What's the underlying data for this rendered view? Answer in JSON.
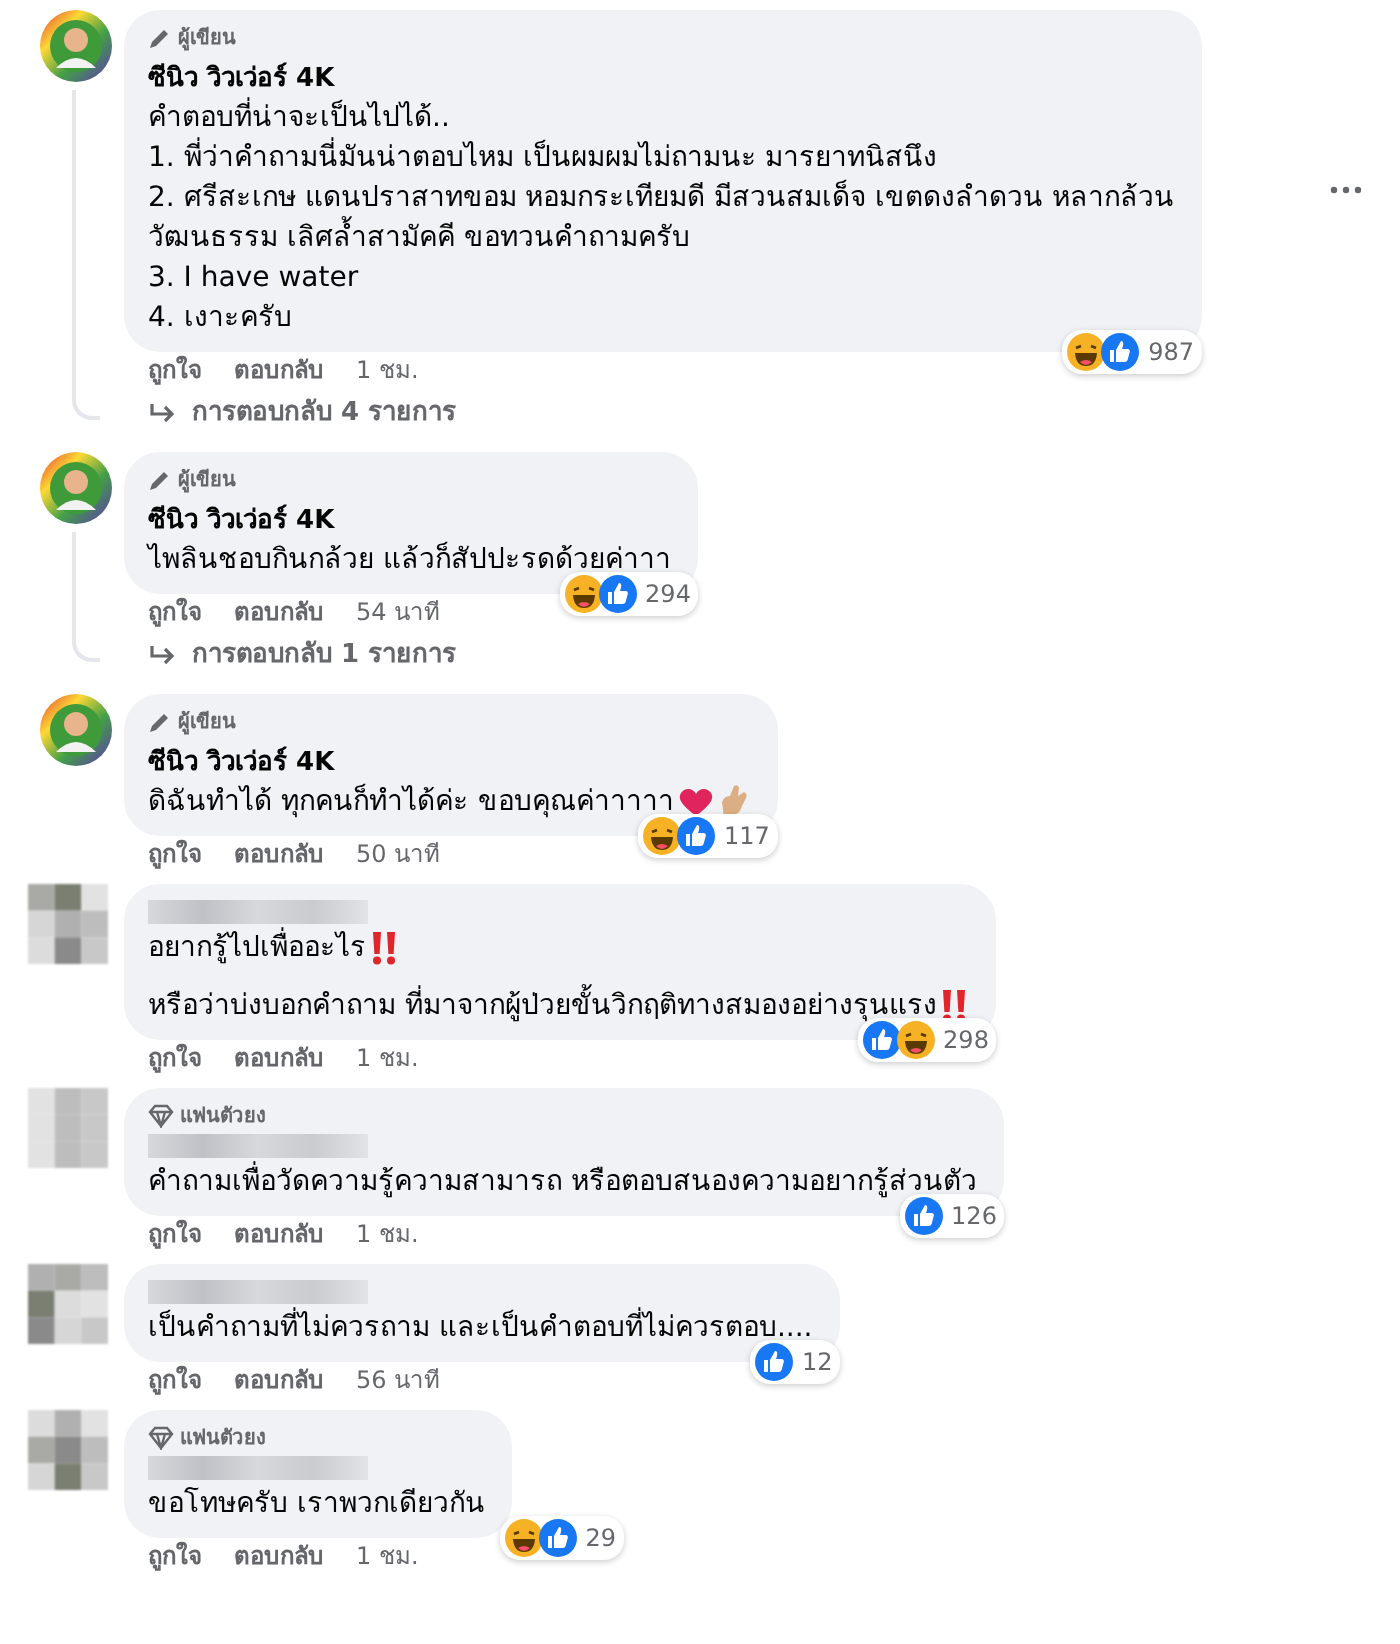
{
  "comments": [
    {
      "avatar": {
        "kind": "ring"
      },
      "badge": {
        "kind": "author",
        "label": "ผู้เขียน"
      },
      "name": "ซีนิว วิวเว่อร์ 4K",
      "more": true,
      "lines": [
        {
          "text": "คำตอบที่น่าจะเป็นไปได้.."
        },
        {
          "text": "1. พี่ว่าคำถามนี่มันน่าตอบไหม เป็นผมผมไม่ถามนะ มารยาทนิสนึง"
        },
        {
          "text": "2. ศรีสะเกษ แดนปราสาทขอม หอมกระเทียมดี มีสวนสมเด็จ เขตดงลำดวน หลากล้วน"
        },
        {
          "text": "วัฒนธรรม เลิศล้ำสามัคคี ขอทวนคำถามครับ"
        },
        {
          "text": "3. I have water"
        },
        {
          "text": "4. เงาะครับ"
        }
      ],
      "actions": [
        "ถูกใจ",
        "ตอบกลับ"
      ],
      "time": "1 ชม.",
      "reactions": [
        {
          "kind": "haha"
        },
        {
          "kind": "like"
        }
      ],
      "count": "987",
      "replies": "การตอบกลับ 4 รายการ"
    },
    {
      "avatar": {
        "kind": "ring"
      },
      "badge": {
        "kind": "author",
        "label": "ผู้เขียน"
      },
      "name": "ซีนิว วิวเว่อร์ 4K",
      "lines": [
        {
          "text": "ไพลินชอบกินกล้วย แล้วก็สัปปะรดด้วยค่าาา"
        }
      ],
      "actions": [
        "ถูกใจ",
        "ตอบกลับ"
      ],
      "time": "54 นาที",
      "reactions": [
        {
          "kind": "haha"
        },
        {
          "kind": "like"
        }
      ],
      "count": "294",
      "replies": "การตอบกลับ 1 รายการ"
    },
    {
      "avatar": {
        "kind": "ring"
      },
      "badge": {
        "kind": "author",
        "label": "ผู้เขียน"
      },
      "name": "ซีนิว วิวเว่อร์ 4K",
      "lines": [
        {
          "text": "ดิฉันทำได้ ทุกคนก็ทำได้ค่ะ ขอบคุณค่าาาาา",
          "trail": [
            {
              "kind": "heart"
            },
            {
              "kind": "pinch"
            }
          ]
        }
      ],
      "actions": [
        "ถูกใจ",
        "ตอบกลับ"
      ],
      "time": "50 นาที",
      "reactions": [
        {
          "kind": "haha"
        },
        {
          "kind": "like"
        }
      ],
      "count": "117"
    },
    {
      "avatar": {
        "kind": "pixel"
      },
      "spaced": true,
      "lines": [
        {
          "text": "อยากรู้ไปเพื่ออะไร",
          "trail": [
            {
              "kind": "double-exclamation"
            }
          ]
        },
        {
          "text": "หรือว่าบ่งบอกคำถาม ที่มาจากผู้ป่วยขั้นวิกฤติทางสมองอย่างรุนแรง",
          "trail": [
            {
              "kind": "double-exclamation"
            }
          ]
        }
      ],
      "actions": [
        "ถูกใจ",
        "ตอบกลับ"
      ],
      "time": "1 ชม.",
      "reactions": [
        {
          "kind": "like"
        },
        {
          "kind": "haha"
        }
      ],
      "count": "298"
    },
    {
      "avatar": {
        "kind": "pixel"
      },
      "badge": {
        "kind": "fan",
        "label": "แฟนตัวยง"
      },
      "lines": [
        {
          "text": "คำถามเพื่อวัดความรู้ความสามารถ หรือตอบสนองความอยากรู้ส่วนตัว"
        }
      ],
      "actions": [
        "ถูกใจ",
        "ตอบกลับ"
      ],
      "time": "1 ชม.",
      "reactions": [
        {
          "kind": "like"
        }
      ],
      "count": "126"
    },
    {
      "avatar": {
        "kind": "pixel"
      },
      "lines": [
        {
          "text": "เป็นคำถามที่ไม่ควรถาม และเป็นคำตอบที่ไม่ควรตอบ...."
        }
      ],
      "actions": [
        "ถูกใจ",
        "ตอบกลับ"
      ],
      "time": "56 นาที",
      "reactions": [
        {
          "kind": "like"
        }
      ],
      "count": "12"
    },
    {
      "avatar": {
        "kind": "pixel"
      },
      "badge": {
        "kind": "fan",
        "label": "แฟนตัวยง"
      },
      "lines": [
        {
          "text": "ขอโทษครับ เราพวกเดียวกัน"
        }
      ],
      "actions": [
        "ถูกใจ",
        "ตอบกลับ"
      ],
      "time": "1 ชม.",
      "reactions": [
        {
          "kind": "haha"
        },
        {
          "kind": "like"
        }
      ],
      "count": "29"
    }
  ]
}
